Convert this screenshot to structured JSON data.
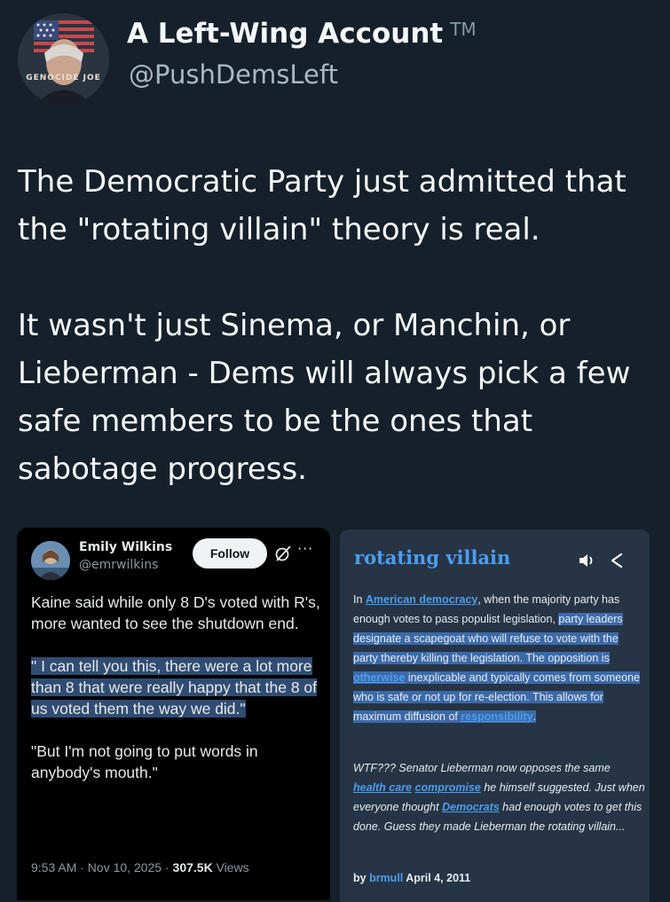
{
  "account": {
    "display_name": "A Left-Wing Account",
    "tm": "TM",
    "handle": "@PushDemsLeft",
    "avatar_text": "GENOCIDE JOE"
  },
  "post": {
    "paragraph1": "The Democratic Party just admitted that the \"rotating villain\" theory is real.",
    "paragraph2": "It wasn't just Sinema, or Manchin, or Lieberman - Dems will always pick a few safe members to be the ones that sabotage progress."
  },
  "embedded_tweet": {
    "name": "Emily Wilkins",
    "handle": "@emrwilkins",
    "follow_label": "Follow",
    "more_label": "···",
    "paragraph1": "Kaine said while only 8 D's voted with R's, more wanted to see the shutdown end.",
    "paragraph2": "\" I can tell you this, there were a lot more than 8 that were really happy that the 8 of us voted them the way we did.\"",
    "paragraph3": "\"But I'm not going to put words in anybody's mouth.\"",
    "time": "9:53 AM · Nov 10, 2025 · ",
    "views_count": "307.5K",
    "views_label": " Views"
  },
  "dictionary": {
    "title": "rotating villain",
    "def_1": "In ",
    "def_link1": "American democracy",
    "def_2": ", when the majority party has enough votes to pass populist legislation, ",
    "def_hl1": "party leaders designate a scapegoat who will refuse to vote with the party thereby killing the legislation. The opposition is ",
    "def_link2": "otherwise",
    "def_hl2": " inexplicable and typically comes from someone who is safe or not up for re-election. This allows for maximum diffusion of ",
    "def_link3": "responsibility",
    "def_end": ".",
    "ex_1": "WTF??? Senator Lieberman now opposes the same ",
    "ex_link1": "health care",
    "ex_space": " ",
    "ex_link2": "compromise",
    "ex_2": " he himself suggested. Just when everyone thought ",
    "ex_link3": "Democrats",
    "ex_3": " had enough votes to get this done. Guess they made Lieberman the rotating villain...",
    "by_label": "by ",
    "author": "brmull",
    "date": " April 4, 2011"
  },
  "icons": [
    "speaker-icon",
    "share-icon",
    "grok-icon",
    "more-icon"
  ],
  "colors": {
    "background": "#15202b",
    "link_blue": "#4b9ef0",
    "dictionary_card": "#263445",
    "tweet_card": "#000000"
  }
}
